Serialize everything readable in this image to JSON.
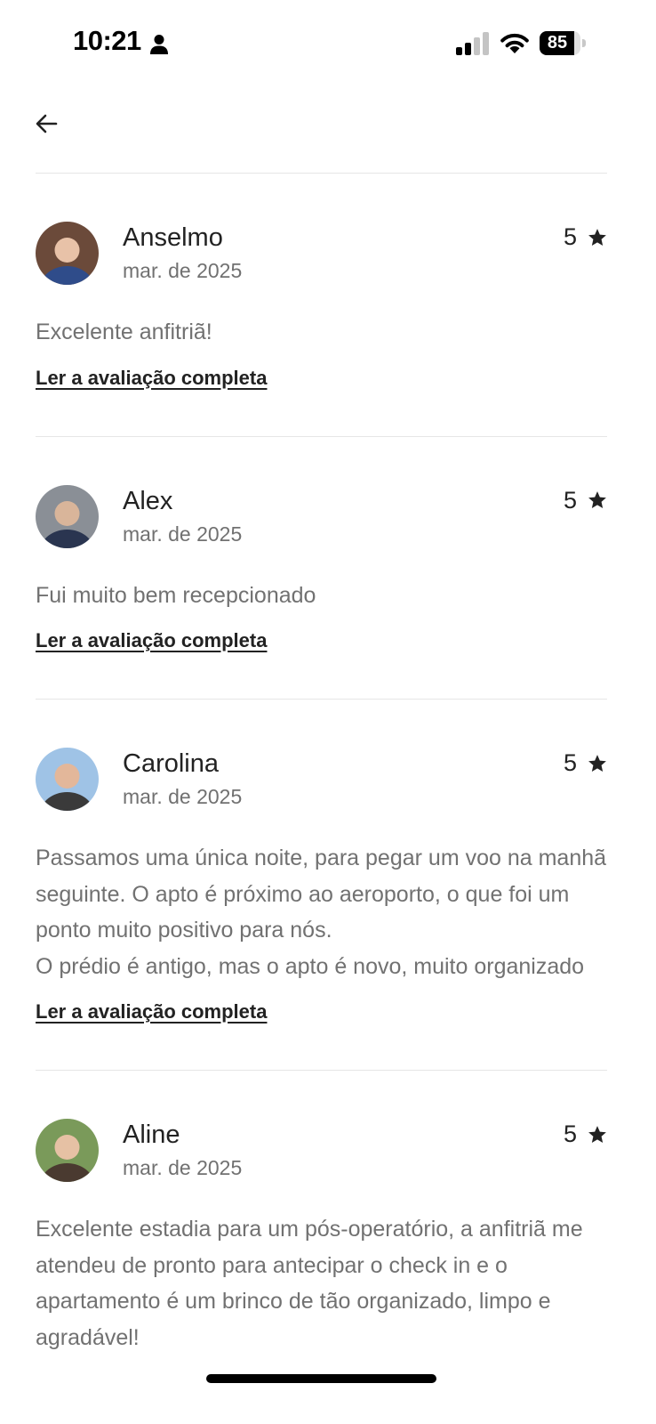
{
  "status_bar": {
    "time": "10:21",
    "battery_level": 85,
    "battery_text": "85",
    "signal_bars_active": 2,
    "signal_bars_total": 4,
    "icons": [
      "person-icon",
      "signal-icon",
      "wifi-icon",
      "battery-icon"
    ]
  },
  "nav": {
    "back_icon": "arrow-left-icon"
  },
  "colors": {
    "primary_text": "#222222",
    "secondary_text": "#717171",
    "divider": "#e6e6e6"
  },
  "reviews": [
    {
      "name": "Anselmo",
      "date": "mar. de 2025",
      "rating": "5",
      "text": "Excelente anfitriã!",
      "link": "Ler a avaliação completa",
      "avatar_icon": "avatar-photo"
    },
    {
      "name": "Alex",
      "date": "mar. de 2025",
      "rating": "5",
      "text": "Fui muito bem recepcionado",
      "link": "Ler a avaliação completa",
      "avatar_icon": "avatar-photo"
    },
    {
      "name": "Carolina",
      "date": "mar. de 2025",
      "rating": "5",
      "text": "Passamos uma única noite, para pegar um voo na manhã seguinte. O apto é próximo ao aeroporto, o que foi um ponto muito positivo para nós.\nO prédio é antigo, mas o apto é novo, muito organizado",
      "link": "Ler a avaliação completa",
      "avatar_icon": "avatar-photo"
    },
    {
      "name": "Aline",
      "date": "mar. de 2025",
      "rating": "5",
      "text": "Excelente estadia para um pós-operatório, a anfitriã me atendeu de pronto para antecipar o check in e o apartamento é um brinco de tão organizado, limpo e agradável!",
      "link": "",
      "avatar_icon": "avatar-photo"
    }
  ]
}
